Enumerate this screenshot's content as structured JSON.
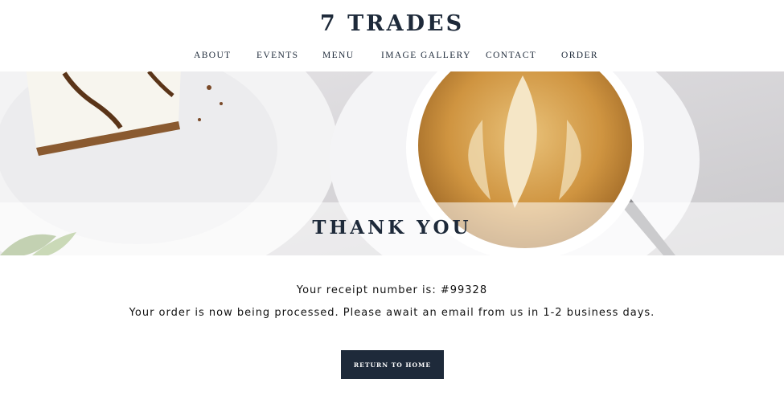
{
  "header": {
    "logo": "7 TRADES",
    "nav": [
      {
        "label": "ABOUT"
      },
      {
        "label": "EVENTS"
      },
      {
        "label": "MENU"
      },
      {
        "label": "IMAGE GALLERY"
      },
      {
        "label": "CONTACT"
      },
      {
        "label": "ORDER"
      }
    ]
  },
  "hero": {
    "title": "THANK YOU",
    "image_subject": "latte-and-cheesecake-photo"
  },
  "main": {
    "receipt_text": "Your receipt number is: #99328",
    "message": "Your order is now being processed. Please await an email from us in 1-2 business days.",
    "button_label": "RETURN TO HOME"
  },
  "colors": {
    "navy": "#1e2a3a",
    "background": "#ffffff",
    "latte": "#c8913c"
  }
}
